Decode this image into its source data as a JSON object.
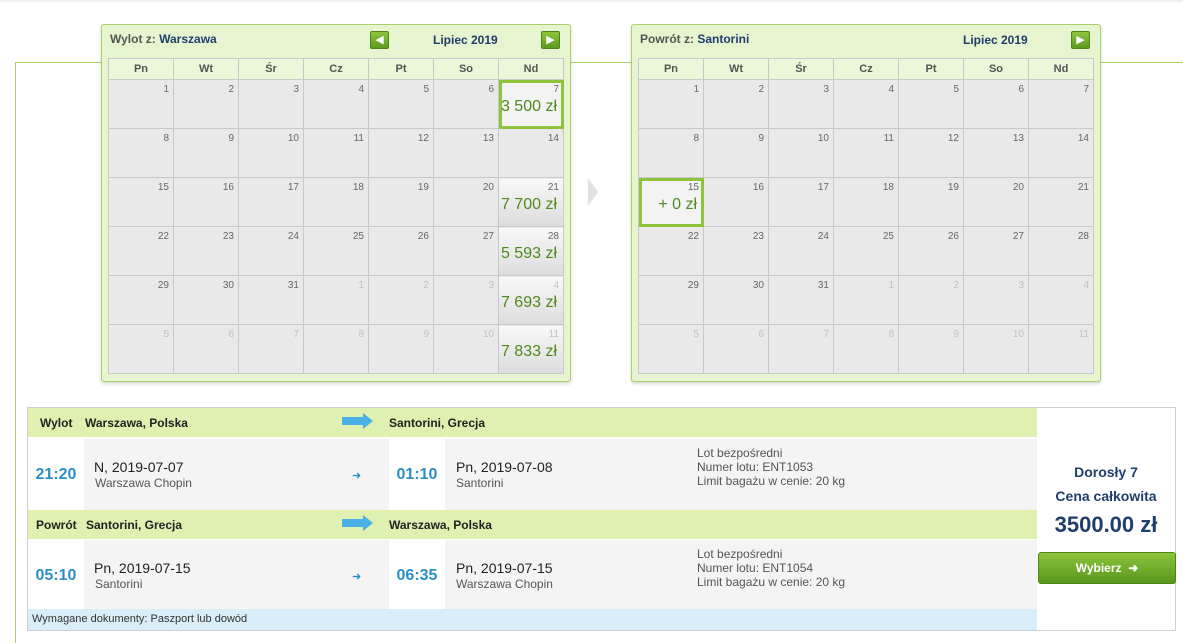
{
  "outbound_calendar": {
    "label": "Wylot z:",
    "city": "Warszawa",
    "month": "Lipiec 2019",
    "prev_icon": "arrow-left-icon",
    "next_icon": "arrow-right-icon",
    "weekdays": [
      "Pn",
      "Wt",
      "Śr",
      "Cz",
      "Pt",
      "So",
      "Nd"
    ],
    "weeks": [
      [
        {
          "d": "1"
        },
        {
          "d": "2"
        },
        {
          "d": "3"
        },
        {
          "d": "4"
        },
        {
          "d": "5"
        },
        {
          "d": "6"
        },
        {
          "d": "7",
          "price": "3 500 zł",
          "selected": true
        }
      ],
      [
        {
          "d": "8"
        },
        {
          "d": "9"
        },
        {
          "d": "10"
        },
        {
          "d": "11"
        },
        {
          "d": "12"
        },
        {
          "d": "13"
        },
        {
          "d": "14"
        }
      ],
      [
        {
          "d": "15"
        },
        {
          "d": "16"
        },
        {
          "d": "17"
        },
        {
          "d": "18"
        },
        {
          "d": "19"
        },
        {
          "d": "20"
        },
        {
          "d": "21",
          "price": "7 700 zł"
        }
      ],
      [
        {
          "d": "22"
        },
        {
          "d": "23"
        },
        {
          "d": "24"
        },
        {
          "d": "25"
        },
        {
          "d": "26"
        },
        {
          "d": "27"
        },
        {
          "d": "28",
          "price": "5 593 zł"
        }
      ],
      [
        {
          "d": "29"
        },
        {
          "d": "30"
        },
        {
          "d": "31"
        },
        {
          "d": "1",
          "other": true
        },
        {
          "d": "2",
          "other": true
        },
        {
          "d": "3",
          "other": true
        },
        {
          "d": "4",
          "other": true,
          "price": "7 693 zł"
        }
      ],
      [
        {
          "d": "5",
          "other": true
        },
        {
          "d": "6",
          "other": true
        },
        {
          "d": "7",
          "other": true
        },
        {
          "d": "8",
          "other": true
        },
        {
          "d": "9",
          "other": true
        },
        {
          "d": "10",
          "other": true
        },
        {
          "d": "11",
          "other": true,
          "price": "7 833 zł"
        }
      ]
    ]
  },
  "return_calendar": {
    "label": "Powrót z:",
    "city": "Santorini",
    "month": "Lipiec 2019",
    "next_icon": "arrow-right-icon",
    "weekdays": [
      "Pn",
      "Wt",
      "Śr",
      "Cz",
      "Pt",
      "So",
      "Nd"
    ],
    "weeks": [
      [
        {
          "d": "1"
        },
        {
          "d": "2"
        },
        {
          "d": "3"
        },
        {
          "d": "4"
        },
        {
          "d": "5"
        },
        {
          "d": "6"
        },
        {
          "d": "7"
        }
      ],
      [
        {
          "d": "8"
        },
        {
          "d": "9"
        },
        {
          "d": "10"
        },
        {
          "d": "11"
        },
        {
          "d": "12"
        },
        {
          "d": "13"
        },
        {
          "d": "14"
        }
      ],
      [
        {
          "d": "15",
          "price": "+ 0 zł",
          "selected": true
        },
        {
          "d": "16"
        },
        {
          "d": "17"
        },
        {
          "d": "18"
        },
        {
          "d": "19"
        },
        {
          "d": "20"
        },
        {
          "d": "21"
        }
      ],
      [
        {
          "d": "22"
        },
        {
          "d": "23"
        },
        {
          "d": "24"
        },
        {
          "d": "25"
        },
        {
          "d": "26"
        },
        {
          "d": "27"
        },
        {
          "d": "28"
        }
      ],
      [
        {
          "d": "29"
        },
        {
          "d": "30"
        },
        {
          "d": "31"
        },
        {
          "d": "1",
          "other": true
        },
        {
          "d": "2",
          "other": true
        },
        {
          "d": "3",
          "other": true
        },
        {
          "d": "4",
          "other": true
        }
      ],
      [
        {
          "d": "5",
          "other": true
        },
        {
          "d": "6",
          "other": true
        },
        {
          "d": "7",
          "other": true
        },
        {
          "d": "8",
          "other": true
        },
        {
          "d": "9",
          "other": true
        },
        {
          "d": "10",
          "other": true
        },
        {
          "d": "11",
          "other": true
        }
      ]
    ]
  },
  "outbound": {
    "label": "Wylot",
    "from": "Warszawa, Polska",
    "to": "Santorini, Grecja",
    "dep_time": "21:20",
    "dep_day": "N,",
    "dep_date": "2019-07-07",
    "dep_airport": "Warszawa Chopin",
    "arr_time": "01:10",
    "arr_day": "Pn,",
    "arr_date": "2019-07-08",
    "arr_airport": "Santorini",
    "type": "Lot bezpośredni",
    "flight_no": "Numer lotu: ENT1053",
    "baggage": "Limit bagażu w cenie: 20 kg"
  },
  "return": {
    "label": "Powrót",
    "from": "Santorini, Grecja",
    "to": "Warszawa, Polska",
    "dep_time": "05:10",
    "dep_day": "Pn,",
    "dep_date": "2019-07-15",
    "dep_airport": "Santorini",
    "arr_time": "06:35",
    "arr_day": "Pn,",
    "arr_date": "2019-07-15",
    "arr_airport": "Warszawa Chopin",
    "type": "Lot bezpośredni",
    "flight_no": "Numer lotu: ENT1054",
    "baggage": "Limit bagażu w cenie: 20 kg"
  },
  "docs": "Wymagane dokumenty: Paszport lub dowód",
  "price_panel": {
    "passengers": "Dorosły 7",
    "total_label": "Cena całkowita",
    "total": "3500.00 zł",
    "choose_label": "Wybierz",
    "choose_icon": "arrow-right-icon"
  },
  "colors": {
    "accent_green": "#8cc43c",
    "price_green": "#4d8a1c",
    "time_blue": "#2a8fc9",
    "bar_green": "#dff0b0",
    "docs_blue": "#d9eef8"
  }
}
